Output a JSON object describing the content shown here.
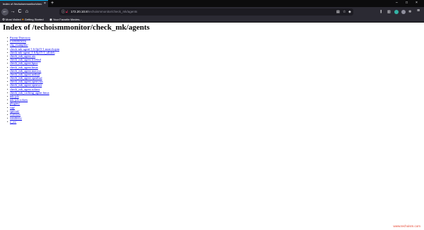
{
  "tabbar": {
    "tab_title": "Index of /techoismmonitor/chec",
    "close_glyph": "×",
    "new_tab_glyph": "+",
    "minimize_glyph": "–",
    "maximize_glyph": "□",
    "window_close_glyph": "×"
  },
  "navbar": {
    "back_glyph": "←",
    "forward_glyph": "→",
    "reload_glyph": "C",
    "home_glyph": "⌂",
    "url_host": "172.20.10.8",
    "url_path": "/techoismmonitor/check_mk/agents",
    "menu_glyph": "≡"
  },
  "bookmarks": {
    "most_visited": "Most Visited",
    "getting_started": "Getting Started",
    "favorite_movies": "Your Favorite Movies..."
  },
  "page": {
    "title": "Index of /techoismmonitor/check_mk/agents",
    "items": [
      "Parent Directory",
      "CONTENTS",
      "cfg_examples/",
      "check-mk-agent-1.6.0p15-1.noarch.rpm",
      "check-mk-agent_1.6.0p15-1_all.deb",
      "check_mk_agent.aix",
      "check_mk_agent.freebsd",
      "check_mk_agent.hpux",
      "check_mk_agent.linux",
      "check_mk_agent.macosx",
      "check_mk_agent.netbsd",
      "check_mk_agent.openbsd",
      "check_mk_agent.openvms",
      "check_mk_agent.openwrt",
      "check_mk_agent.solaris",
      "check_mk_caching_agent.linux",
      "mk-job",
      "mk-job.solaris",
      "plugins/",
      "sap/",
      "special/",
      "waitmax",
      "windows/",
      "z_os/"
    ],
    "watermark": "www.techoism.com"
  },
  "colors": {
    "chrome_dark": "#2b2a33",
    "tabbar_bg": "#0c0c0d",
    "link": "#0000ee",
    "insecure_lock": "#e22850",
    "watermark": "#e6452f"
  }
}
